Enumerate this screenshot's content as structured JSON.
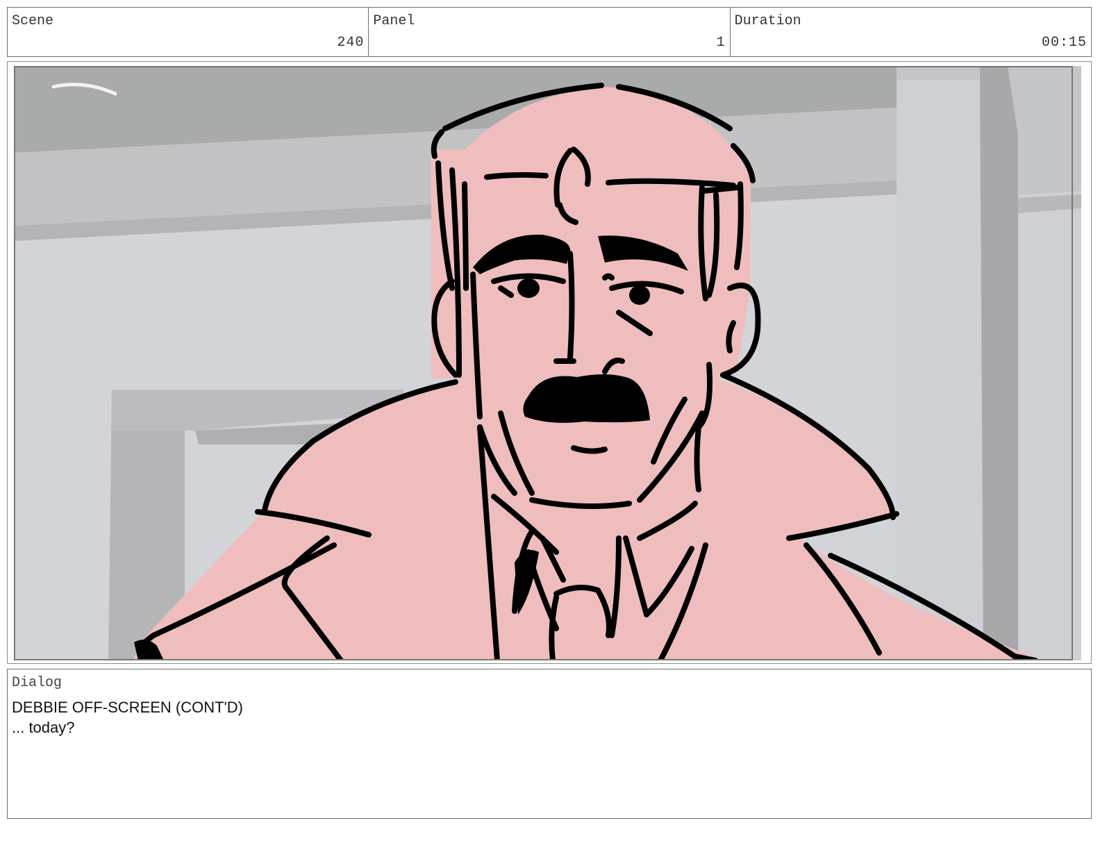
{
  "header": {
    "scene_label": "Scene",
    "scene_value": "240",
    "panel_label": "Panel",
    "panel_value": "1",
    "duration_label": "Duration",
    "duration_value": "00:15"
  },
  "artwork": {
    "subject": "storyboard-sketch-man-with-mustache-in-trench-coat",
    "colors": {
      "background": "#d3d4d8",
      "ceiling": "#a9aaaa",
      "skin_fill": "#efbdbd",
      "ink": "#000000",
      "pillar": "#b5b5b8"
    }
  },
  "dialog": {
    "label": "Dialog",
    "speaker": "DEBBIE OFF-SCREEN (CONT'D)",
    "line": "... today?"
  }
}
